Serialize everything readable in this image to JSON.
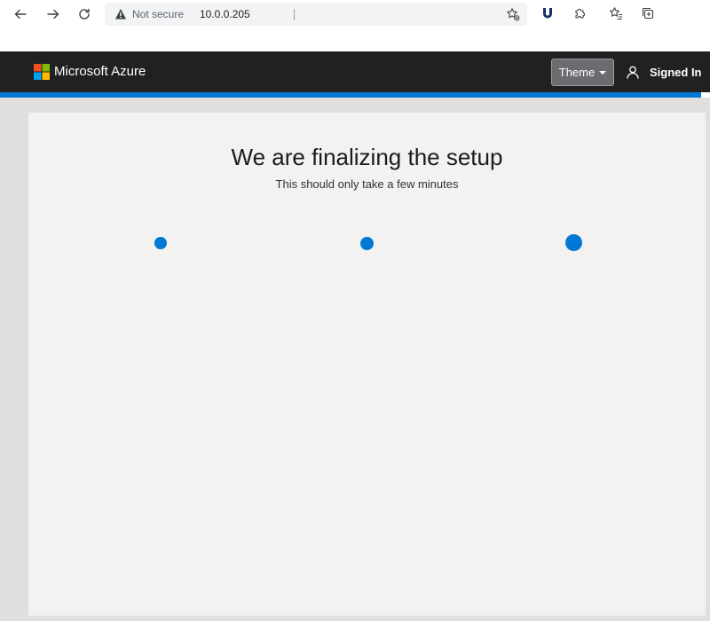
{
  "browser": {
    "security_label": "Not secure",
    "url": "10.0.0.205"
  },
  "header": {
    "brand": "Microsoft Azure",
    "theme_label": "Theme",
    "signed_in_label": "Signed In"
  },
  "main": {
    "title": "We are finalizing the setup",
    "subtitle": "This should only take a few minutes"
  },
  "colors": {
    "accent": "#0078d4",
    "header_bg": "#212121",
    "panel_bg": "#f3f2f1",
    "page_bg": "#e1dfdd"
  },
  "icons": {
    "back": "back-arrow-icon",
    "forward": "forward-arrow-icon",
    "reload": "reload-icon",
    "warning": "warning-icon",
    "favorite": "favorite-star-icon",
    "extension1": "shield-extension-icon",
    "extensions": "puzzle-icon",
    "favorites": "favorites-list-icon",
    "collections": "collections-icon",
    "user": "user-icon"
  }
}
